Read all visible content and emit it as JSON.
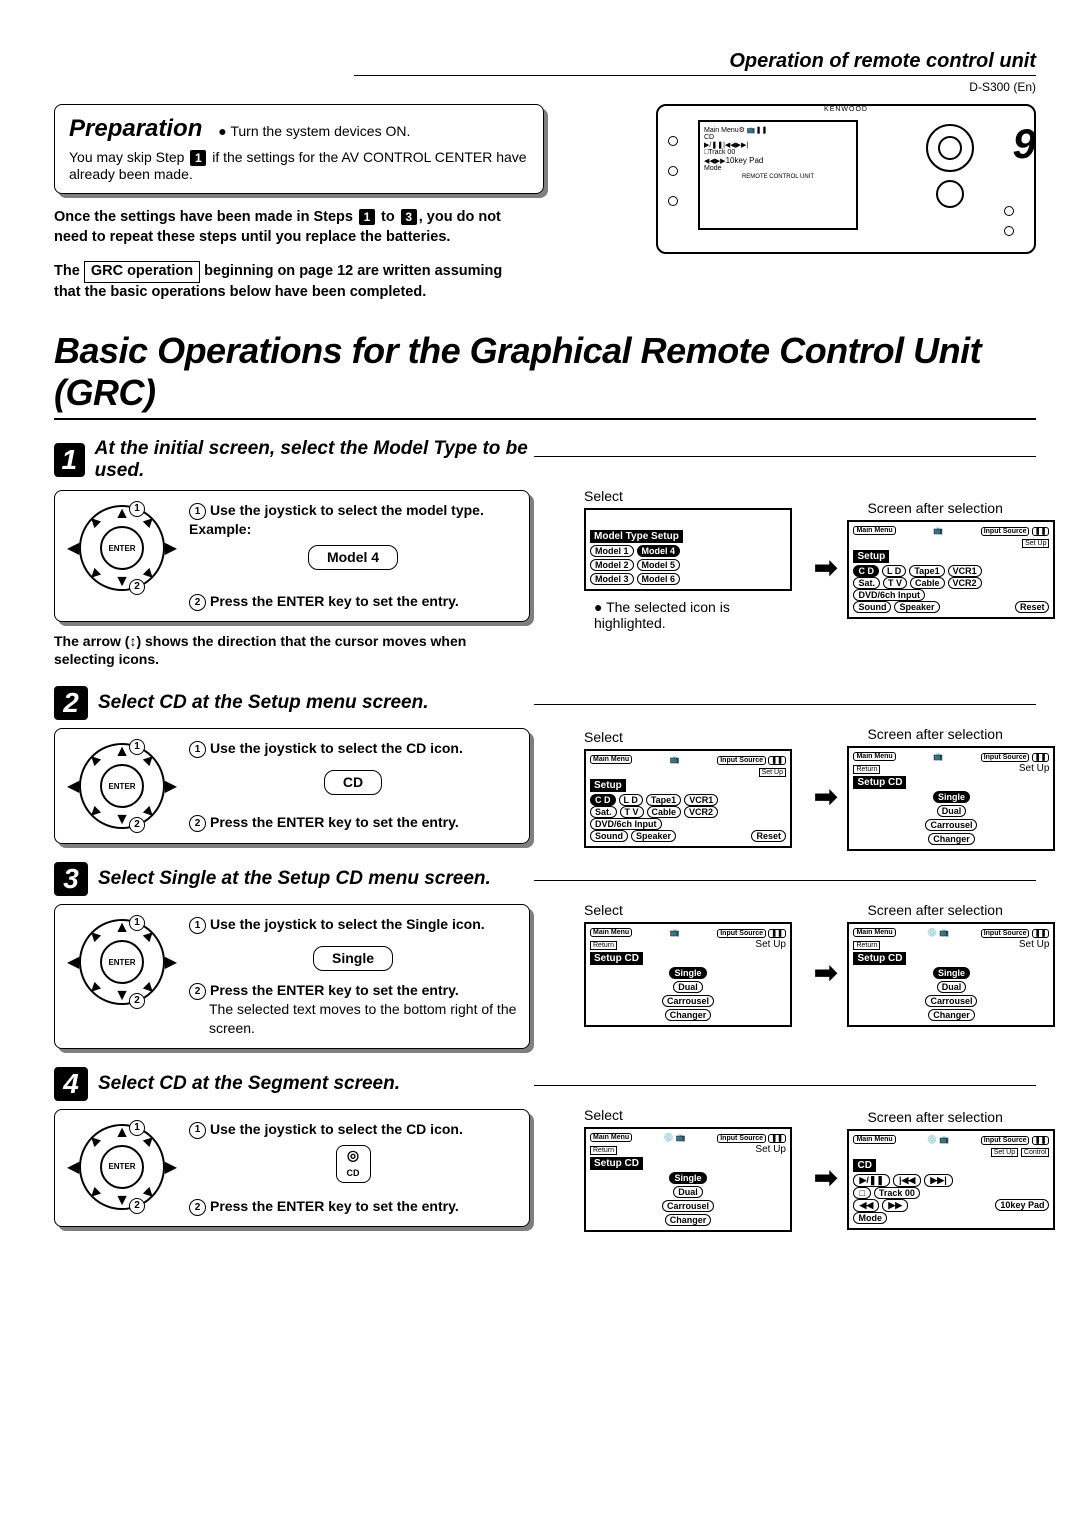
{
  "header": {
    "section_title": "Operation of remote control unit",
    "model_code": "D-S300 (En)",
    "page_number": "9"
  },
  "preparation": {
    "title": "Preparation",
    "bullet": "Turn the system devices ON.",
    "skip_note_1": "You may skip Step",
    "skip_note_2": "if the settings for the AV CONTROL CENTER have already been made.",
    "once_note": "Once the settings have been made in Steps ① to ③, you do not need to repeat these steps until you replace the batteries.",
    "grc_label": "GRC operation",
    "grc_note_1": "The",
    "grc_note_2": "beginning on page 12 are written assuming that the basic operations below have been completed."
  },
  "main_title": "Basic Operations for the Graphical Remote Control Unit (GRC)",
  "steps": {
    "s1": {
      "num": "1",
      "title": "At the initial screen, select the Model Type to be used.",
      "a": "Use the joystick to select the model type.",
      "example_label": "Example:",
      "pill": "Model 4",
      "b": "Press the ENTER key to set the entry.",
      "footnote": "The arrow (↕) shows the direction that the cursor moves when selecting icons.",
      "select_label": "Select",
      "after_label": "Screen after selection",
      "selected_note": "The selected icon is highlighted.",
      "screen_left_title": "Model Type Setup",
      "models_left": [
        "Model 1",
        "Model 2",
        "Model 3"
      ],
      "models_right": [
        "Model 4",
        "Model 5",
        "Model 6"
      ],
      "setup_label": "Setup",
      "row1": [
        "C D",
        "L D",
        "Tape1",
        "VCR1"
      ],
      "row2": [
        "Sat.",
        "T V",
        "Cable",
        "VCR2"
      ],
      "row3": "DVD/6ch Input",
      "row4": [
        "Sound",
        "Speaker",
        "Reset"
      ],
      "main_menu": "Main Menu",
      "tuner": "Tuner",
      "input_source": "Input Source",
      "setup_btn": "Set Up"
    },
    "s2": {
      "num": "2",
      "title": "Select CD at the Setup menu screen.",
      "a": "Use the joystick to select the CD icon.",
      "pill": "CD",
      "b": "Press the ENTER key to set the entry.",
      "select_label": "Select",
      "after_label": "Screen after selection",
      "setup_cd": "Setup CD",
      "options": [
        "Single",
        "Dual",
        "Carrousel",
        "Changer"
      ],
      "return_label": "Return"
    },
    "s3": {
      "num": "3",
      "title": "Select Single at the Setup CD menu screen.",
      "a": "Use the joystick to select the Single icon.",
      "pill": "Single",
      "b": "Press the ENTER key to set the entry.",
      "extra": "The selected text moves to the bottom right of the screen.",
      "select_label": "Select",
      "after_label": "Screen after selection"
    },
    "s4": {
      "num": "4",
      "title": "Select CD at the Segment screen.",
      "a": "Use the joystick to select the CD icon.",
      "b": "Press the ENTER key to set the entry.",
      "select_label": "Select",
      "after_label": "Screen after selection",
      "cd_label": "CD",
      "track": "Track 00",
      "mode": "Mode",
      "tenkey": "10key Pad",
      "control_label": "Control"
    }
  },
  "remote": {
    "brand": "KENWOOD",
    "main_menu": "Main Menu",
    "cd": "CD",
    "track": "Track 00",
    "mode": "Mode",
    "tenkey": "10key Pad",
    "unit_label": "REMOTE CONTROL UNIT"
  }
}
